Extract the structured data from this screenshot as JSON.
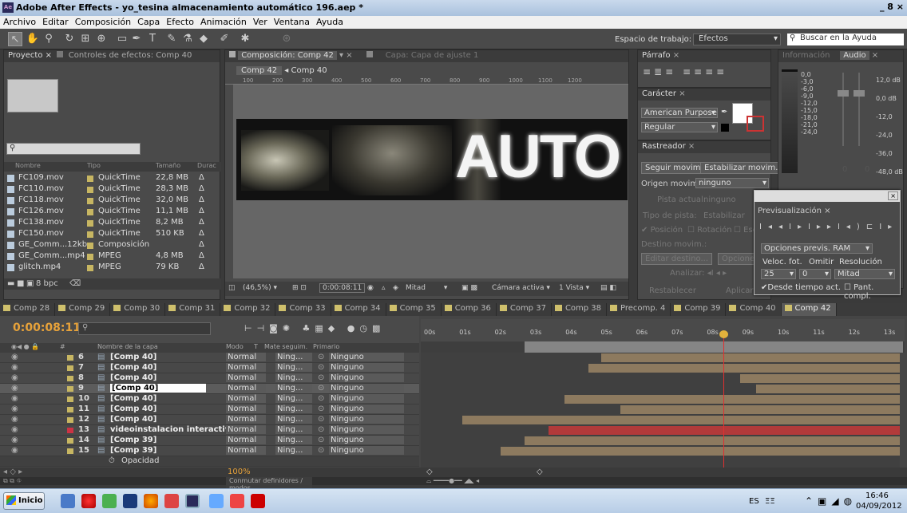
{
  "window": {
    "title": "Adobe After Effects - yo_tesina almacenamiento automático 196.aep *",
    "controls": "_ 8 ×"
  },
  "menu": [
    "Archivo",
    "Editar",
    "Composición",
    "Capa",
    "Efecto",
    "Animación",
    "Ver",
    "Ventana",
    "Ayuda"
  ],
  "toolbar": {
    "workspace_label": "Espacio de trabajo:",
    "workspace": "Efectos",
    "help_placeholder": "Buscar en la Ayuda"
  },
  "project": {
    "tabs": [
      "Proyecto ×",
      "Controles de efectos: Comp 40"
    ],
    "columns": [
      "Nombre",
      "Tipo",
      "Tamaño",
      "Durac"
    ],
    "items": [
      {
        "name": "FC109.mov",
        "type": "QuickTime",
        "size": "22,8 MB",
        "dur": "Δ"
      },
      {
        "name": "FC110.mov",
        "type": "QuickTime",
        "size": "28,3 MB",
        "dur": "Δ"
      },
      {
        "name": "FC118.mov",
        "type": "QuickTime",
        "size": "32,0 MB",
        "dur": "Δ"
      },
      {
        "name": "FC126.mov",
        "type": "QuickTime",
        "size": "11,1 MB",
        "dur": "Δ"
      },
      {
        "name": "FC138.mov",
        "type": "QuickTime",
        "size": "8,2 MB",
        "dur": "Δ"
      },
      {
        "name": "FC150.mov",
        "type": "QuickTime",
        "size": "510 KB",
        "dur": "Δ"
      },
      {
        "name": "GE_Comm...12kb",
        "type": "Composición",
        "size": "",
        "dur": "Δ"
      },
      {
        "name": "GE_Comm...mp4",
        "type": "MPEG",
        "size": "4,8 MB",
        "dur": "Δ"
      },
      {
        "name": "glitch.mp4",
        "type": "MPEG",
        "size": "79 KB",
        "dur": "Δ"
      }
    ],
    "bpc": "8 bpc"
  },
  "comp": {
    "tab": "Composición: Comp 42",
    "layer_tab": "Capa: Capa de ajuste 1",
    "breadcrumb": [
      "Comp 42",
      "Comp 40"
    ],
    "ruler": [
      "100",
      "200",
      "300",
      "400",
      "500",
      "600",
      "700",
      "800",
      "900",
      "1000",
      "1100",
      "1200"
    ],
    "frame_text": "AUTO",
    "footer": {
      "zoom": "(46,5%)",
      "time": "0:00:08:11",
      "quality": "Mitad",
      "camera": "Cámara activa",
      "views": "1 Vista"
    }
  },
  "paragraph": {
    "tab": "Párrafo"
  },
  "character": {
    "tab": "Carácter",
    "font": "American Purpose",
    "style": "Regular"
  },
  "tracker": {
    "tab": "Rastreador",
    "track": "Seguir movim.",
    "stabilize": "Estabilizar movim.",
    "origin_label": "Origen movim.:",
    "origin": "ninguno",
    "current_label": "Pista actual:",
    "current": "ninguno",
    "type_label": "Tipo de pista:",
    "type": "Estabilizar",
    "pos": "Posición",
    "rot": "Rotación",
    "esc": "Esc",
    "dest": "Destino movim.:",
    "edit": "Editar destino...",
    "options": "Opciones...",
    "analyze": "Analizar:",
    "reset": "Restablecer",
    "apply": "Aplicar"
  },
  "info": {
    "tabs": [
      "Información",
      "Audio"
    ],
    "left_db": [
      "0,0",
      "-3,0",
      "-6,0",
      "-9,0",
      "-12,0",
      "-15,0",
      "-18,0",
      "-21,0",
      "-24,0"
    ],
    "right_db": [
      "12,0 dB",
      "0,0 dB",
      "-12,0",
      "-24,0",
      "-36,0",
      "-48,0 dB"
    ],
    "zero_a": "0",
    "zero_b": "0"
  },
  "preview": {
    "tab": "Previsualización",
    "ram_opts": "Opciones previs. RAM",
    "fps_label": "Veloc. fot.",
    "skip_label": "Omitir",
    "res_label": "Resolución",
    "fps": "25",
    "skip": "0",
    "res": "Mitad",
    "from_current": "Desde tiempo act.",
    "fullscreen": "Pant. compl."
  },
  "comp_tabs": [
    "Comp 28",
    "Comp 29",
    "Comp 30",
    "Comp 31",
    "Comp 32",
    "Comp 33",
    "Comp 34",
    "Comp 35",
    "Comp 36",
    "Comp 37",
    "Comp 38",
    "Precomp. 4",
    "Comp 39",
    "Comp 40",
    "Comp 42"
  ],
  "timeline": {
    "timecode": "0:00:08:11",
    "headers": {
      "num": "#",
      "name": "Nombre de la capa",
      "mode": "Modo",
      "t": "T",
      "matte": "Mate seguim.",
      "parent": "Primario"
    },
    "ticks": [
      "00s",
      "01s",
      "02s",
      "03s",
      "04s",
      "05s",
      "06s",
      "07s",
      "08s",
      "09s",
      "10s",
      "11s",
      "12s",
      "13s"
    ],
    "layers": [
      {
        "num": "6",
        "name": "[Comp 40]",
        "mode": "Normal",
        "matte": "Ning...",
        "parent": "Ninguno"
      },
      {
        "num": "7",
        "name": "[Comp 40]",
        "mode": "Normal",
        "matte": "Ning...",
        "parent": "Ninguno"
      },
      {
        "num": "8",
        "name": "[Comp 40]",
        "mode": "Normal",
        "matte": "Ning...",
        "parent": "Ninguno"
      },
      {
        "num": "9",
        "name": "[Comp 40]",
        "mode": "Normal",
        "matte": "Ning...",
        "parent": "Ninguno"
      },
      {
        "num": "10",
        "name": "[Comp 40]",
        "mode": "Normal",
        "matte": "Ning...",
        "parent": "Ninguno"
      },
      {
        "num": "11",
        "name": "[Comp 40]",
        "mode": "Normal",
        "matte": "Ning...",
        "parent": "Ninguno"
      },
      {
        "num": "12",
        "name": "[Comp 40]",
        "mode": "Normal",
        "matte": "Ning...",
        "parent": "Ninguno"
      },
      {
        "num": "13",
        "name": "videoinstalacion interactiva",
        "mode": "Normal",
        "matte": "Ning...",
        "parent": "Ninguno"
      },
      {
        "num": "14",
        "name": "[Comp 39]",
        "mode": "Normal",
        "matte": "Ning...",
        "parent": "Ninguno"
      },
      {
        "num": "15",
        "name": "[Comp 39]",
        "mode": "Normal",
        "matte": "Ning...",
        "parent": "Ninguno"
      }
    ],
    "opacity_label": "Opacidad",
    "opacity_value": "100%",
    "toggle": "Conmutar definidores / modos"
  },
  "taskbar": {
    "start": "Inicio",
    "lang": "ES",
    "time": "16:46",
    "date": "04/09/2012"
  }
}
